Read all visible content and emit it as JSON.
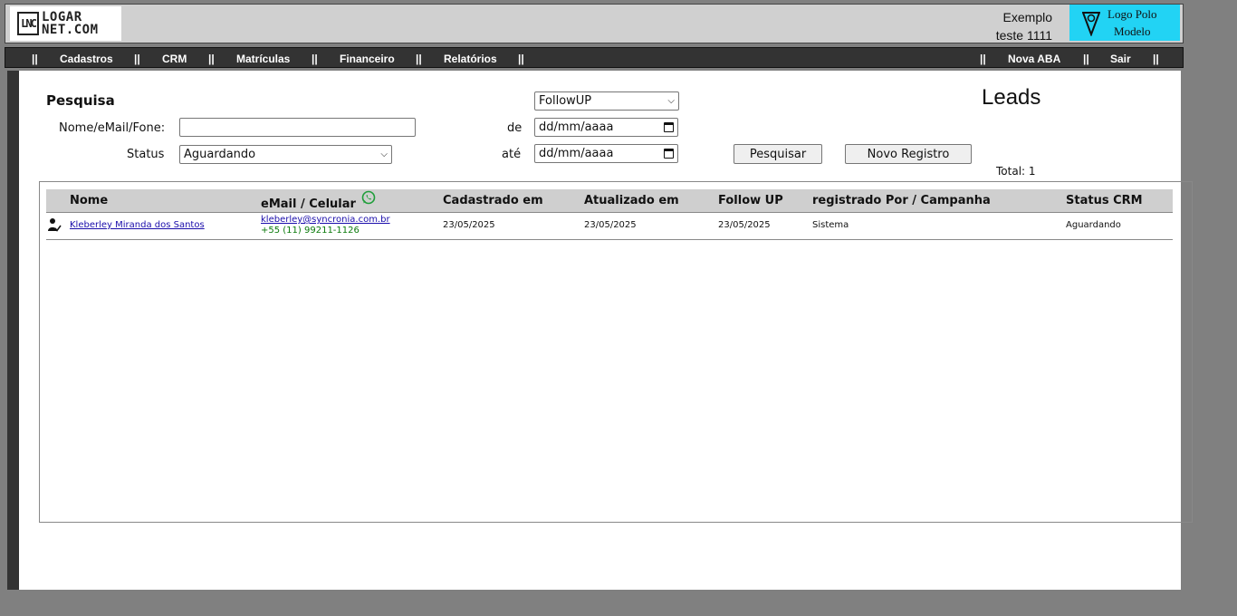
{
  "header": {
    "logo_mark": "LNC",
    "logo_line1": "LOGAR",
    "logo_line2": "NET.COM",
    "user_line1": "Exemplo",
    "user_line2": "teste 1111",
    "polo_line1": "Logo Polo",
    "polo_line2": "Modelo"
  },
  "nav": {
    "separator": "||",
    "items": [
      "Cadastros",
      "CRM",
      "Matrículas",
      "Financeiro",
      "Relatórios"
    ],
    "right_items": [
      "Nova ABA",
      "Sair"
    ]
  },
  "search": {
    "title": "Pesquisa",
    "name_label": "Nome/eMail/Fone:",
    "name_value": "",
    "status_label": "Status",
    "status_value": "Aguardando",
    "date_type_value": "FollowUP",
    "from_label": "de",
    "from_value": "dd/mm/aaaa",
    "to_label": "até",
    "to_value": "dd/mm/aaaa",
    "search_button": "Pesquisar",
    "new_button": "Novo Registro"
  },
  "page": {
    "title": "Leads",
    "total": "Total: 1"
  },
  "table": {
    "columns": [
      "Nome",
      "eMail / Celular",
      "Cadastrado em",
      "Atualizado em",
      "Follow UP",
      "registrado Por / Campanha",
      "Status CRM"
    ],
    "rows": [
      {
        "name": "Kleberley Miranda dos Santos",
        "email": "kleberley@syncronia.com.br",
        "phone": "+55 (11) 99211-1126",
        "created": "23/05/2025",
        "updated": "23/05/2025",
        "followup": "23/05/2025",
        "registered_by": "Sistema",
        "status": "Aguardando"
      }
    ]
  },
  "colors": {
    "polo_bg": "#22d3f4",
    "nav_bg": "#333333",
    "header_bg": "#d0d0d0",
    "whatsapp": "#1f9e3a",
    "link": "#1a0dab",
    "phone": "#0a7a0a"
  },
  "icons": {
    "whatsapp": "whatsapp-icon",
    "user": "user-check-icon",
    "calendar": "calendar-icon",
    "polo": "shield-logo-icon"
  }
}
